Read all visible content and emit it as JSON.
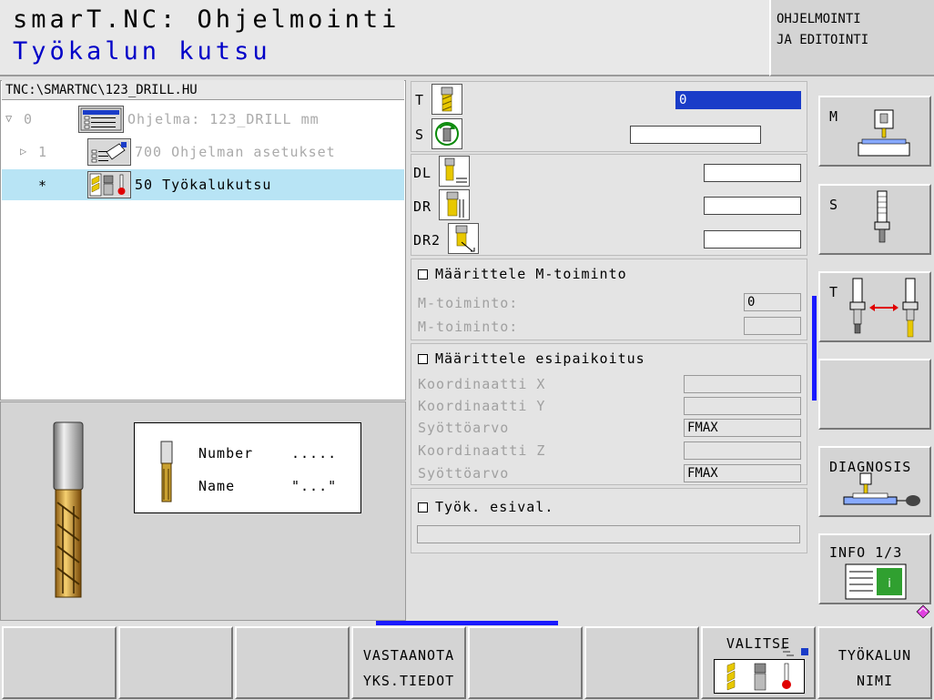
{
  "header": {
    "title": "smarT.NC: Ohjelmointi",
    "subtitle": "Työkalun kutsu",
    "mode_line1": "OHJELMOINTI",
    "mode_line2": "JA EDITOINTI"
  },
  "tree": {
    "path": "TNC:\\SMARTNC\\123_DRILL.HU",
    "rows": [
      {
        "num": "0",
        "label": "Ohjelma: 123_DRILL mm"
      },
      {
        "num": "1",
        "label": "700 Ohjelman asetukset"
      },
      {
        "num": "*",
        "label": "50 Työkalukutsu"
      }
    ]
  },
  "preview": {
    "number_label": "Number",
    "number_value": ".....",
    "name_label": "Name",
    "name_value": "\"...\""
  },
  "form": {
    "t_label": "T",
    "t_value": "0",
    "s_label": "S",
    "s_value": "",
    "dl_label": "DL",
    "dl_value": "",
    "dr_label": "DR",
    "dr_value": "",
    "dr2_label": "DR2",
    "dr2_value": "",
    "m_group_label": "Määrittele M-toiminto",
    "m1_label": "M-toiminto:",
    "m1_value": "0",
    "m2_label": "M-toiminto:",
    "m2_value": "",
    "pre_group_label": "Määrittele esipaikoitus",
    "coord_x_label": "Koordinaatti X",
    "coord_x_value": "",
    "coord_y_label": "Koordinaatti Y",
    "coord_y_value": "",
    "feed1_label": "Syöttöarvo",
    "feed1_value": "FMAX",
    "coord_z_label": "Koordinaatti Z",
    "coord_z_value": "",
    "feed2_label": "Syöttöarvo",
    "feed2_value": "FMAX",
    "presel_group_label": "Työk. esival.",
    "presel_value": ""
  },
  "right_softkeys": {
    "m": "M",
    "s": "S",
    "t": "T",
    "diagnosis": "DIAGNOSIS",
    "info": "INFO 1/3"
  },
  "bottom_softkeys": {
    "receive_line1": "VASTAANOTA",
    "receive_line2": "YKS.TIEDOT",
    "select": "VALITSE",
    "toolname_line1": "TYÖKALUN",
    "toolname_line2": "NIMI"
  },
  "colors": {
    "accent_blue": "#0000c8",
    "selection": "#b8e4f5",
    "scrollbar": "#1a1aff"
  }
}
